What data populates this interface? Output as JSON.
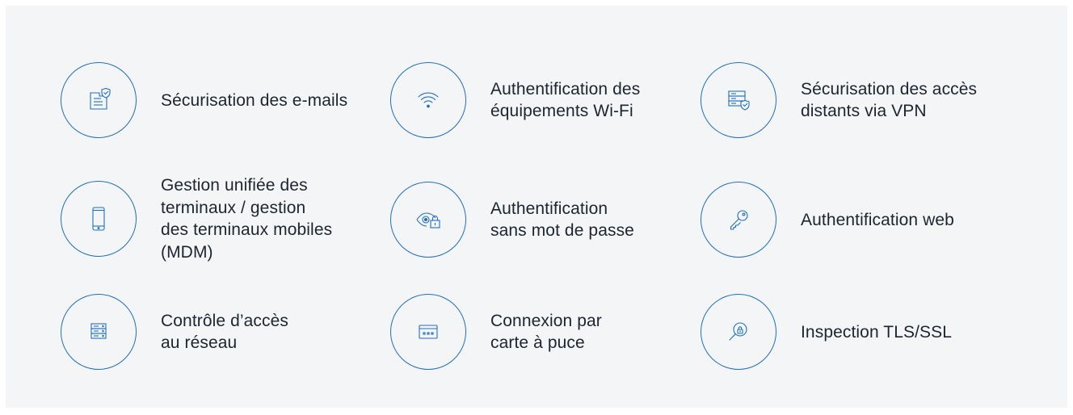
{
  "accent_color": "#1f6fbf",
  "items": [
    {
      "label": "Sécurisation des e-mails",
      "icon": "email-shield-icon"
    },
    {
      "label": "Authentification des\néquipements Wi-Fi",
      "icon": "wifi-icon"
    },
    {
      "label": "Sécurisation des accès\ndistants via VPN",
      "icon": "server-shield-icon"
    },
    {
      "label": "Gestion unifiée des\nterminaux / gestion\ndes terminaux mobiles\n(MDM)",
      "icon": "mobile-phone-icon"
    },
    {
      "label": "Authentification\nsans mot de passe",
      "icon": "eye-lock-icon"
    },
    {
      "label": "Authentification web",
      "icon": "key-icon"
    },
    {
      "label": "Contrôle d’accès\nau réseau",
      "icon": "server-rack-icon"
    },
    {
      "label": "Connexion par\ncarte à puce",
      "icon": "smart-card-icon"
    },
    {
      "label": "Inspection TLS/SSL",
      "icon": "magnifier-lock-icon"
    }
  ]
}
